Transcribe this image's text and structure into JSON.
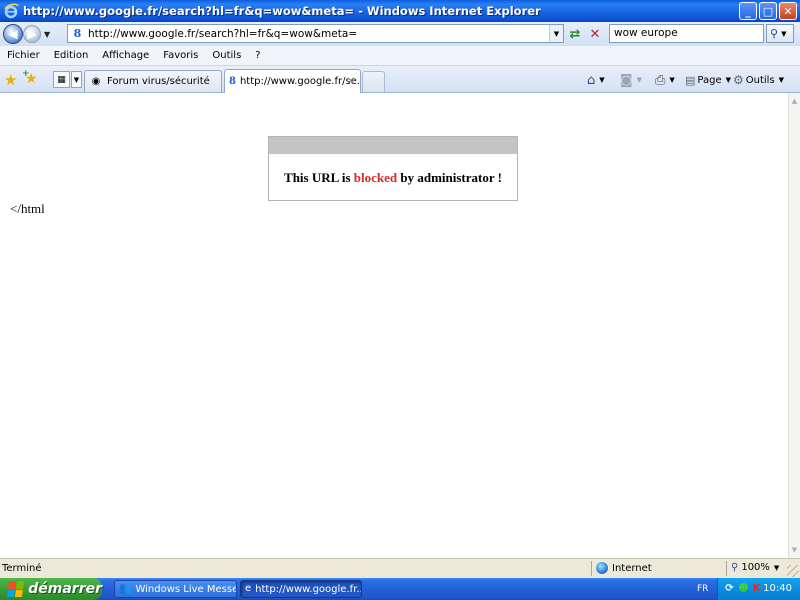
{
  "window": {
    "title": "http://www.google.fr/search?hl=fr&q=wow&meta= - Windows Internet Explorer",
    "min_label": "_",
    "max_label": "□",
    "close_label": "✕"
  },
  "address_bar": {
    "url": "http://www.google.fr/search?hl=fr&q=wow&meta=",
    "site_icon": "8"
  },
  "search_bar": {
    "value": "wow europe"
  },
  "menu": {
    "items": [
      "Fichier",
      "Edition",
      "Affichage",
      "Favoris",
      "Outils",
      "?"
    ]
  },
  "tabs": [
    {
      "label": "Forum virus/sécurité",
      "active": false
    },
    {
      "label": "http://www.google.fr/se...",
      "active": true
    }
  ],
  "commands": {
    "page_label": "Page",
    "tools_label": "Outils"
  },
  "page": {
    "message_before": "This URL is ",
    "message_highlight": "blocked",
    "message_after": " by administrator !",
    "stray_text": "</html"
  },
  "status": {
    "text": "Terminé",
    "zone": "Internet",
    "zoom": "100%"
  },
  "taskbar": {
    "start_label": "démarrer",
    "tasks": [
      {
        "label": "Windows Live Messen...",
        "active": false
      },
      {
        "label": "http://www.google.fr...",
        "active": true
      }
    ],
    "language": "FR",
    "time": "10:40"
  },
  "colors": {
    "blocked_text": "#d42a2a",
    "titlebar": "#0a5fe0",
    "start_button": "#3a9e36"
  }
}
